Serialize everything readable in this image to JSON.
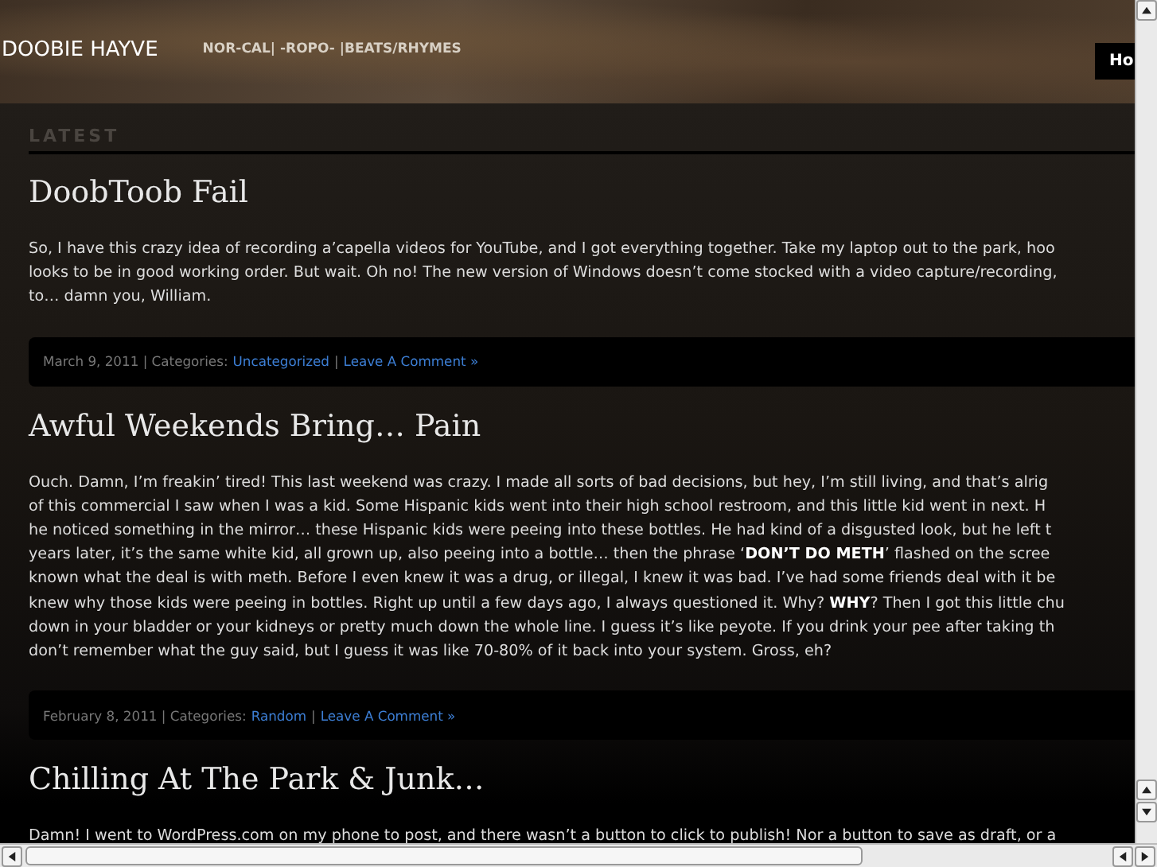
{
  "header": {
    "site_title": "DOOBIE HAYVE",
    "tagline": "NOR-CAL| -ROPO- |BEATS/RHYMES",
    "nav_button": "Ho"
  },
  "section_heading": "LATEST",
  "posts": [
    {
      "title": "DoobToob Fail",
      "lines": [
        "So, I have this crazy idea of recording a’capella videos for YouTube, and I got everything together. Take my laptop out to the park, hoo",
        "looks to be in good working order. But wait. Oh no! The new version of Windows doesn’t come stocked with a video capture/recording,",
        "to… damn you, William."
      ],
      "meta": {
        "info": "March 9, 2011 | Categories:",
        "category": "Uncategorized",
        "separator": "|",
        "comment_link": "Leave A Comment »"
      }
    },
    {
      "title": "Awful Weekends Bring… Pain",
      "lines": [
        "Ouch. Damn, I’m freakin’ tired! This last weekend was crazy. I made all sorts of bad decisions, but hey, I’m still living, and that’s alrig",
        "of this commercial I saw when I was a kid. Some Hispanic kids went into their high school restroom, and this little kid went in next. H",
        "he noticed something in the mirror… these Hispanic kids were peeing into these bottles. He had kind of a disgusted look, but he left t",
        "years later, it’s the same white kid, all grown up, also peeing into a bottle… then the phrase ‘**DON’T DO METH**’ flashed on the scree",
        "known what the deal is with meth. Before I even knew it was a drug, or illegal, I knew it was bad. I’ve had some friends deal with it be",
        "knew why those kids were peeing in bottles. Right up until a few days ago, I always questioned it. Why? **WHY**? Then I got this little chu",
        "down in your bladder or your kidneys or pretty much down the whole line. I guess it’s like peyote. If you drink your pee after taking th",
        "don’t remember what the guy said, but I guess it was like 70-80% of it back into your system. Gross, eh?"
      ],
      "meta": {
        "info": "February 8, 2011 | Categories:",
        "category": "Random",
        "separator": "|",
        "comment_link": "Leave A Comment »"
      }
    },
    {
      "title": "Chilling At The Park & Junk…",
      "lines": [
        "Damn! I went to WordPress.com on my phone to post, and there wasn’t a button to click to publish! Nor a button to save as draft, or a"
      ]
    }
  ]
}
